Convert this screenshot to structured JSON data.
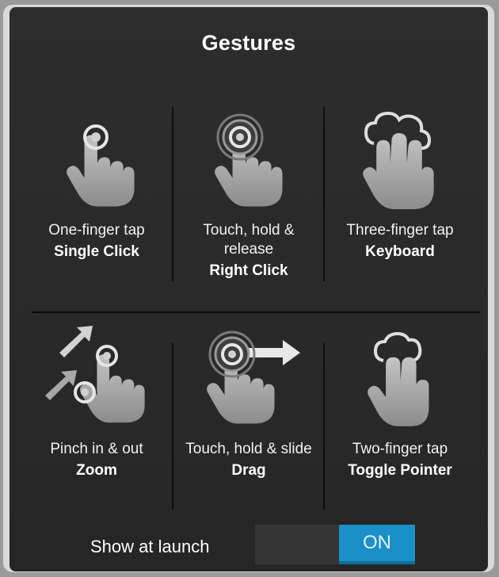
{
  "dialog": {
    "title": "Gestures"
  },
  "gestures": [
    {
      "description": "One-finger tap",
      "action": "Single Click",
      "icon": "one-finger-tap-icon"
    },
    {
      "description_lines": [
        "Touch, hold &",
        "release"
      ],
      "action": "Right Click",
      "icon": "touch-hold-release-icon"
    },
    {
      "description": "Three-finger tap",
      "action": "Keyboard",
      "icon": "three-finger-tap-icon"
    },
    {
      "description": "Pinch in & out",
      "action": "Zoom",
      "icon": "pinch-icon"
    },
    {
      "description": "Touch, hold & slide",
      "action": "Drag",
      "icon": "touch-hold-slide-icon"
    },
    {
      "description": "Two-finger tap",
      "action": "Toggle Pointer",
      "icon": "two-finger-tap-icon"
    }
  ],
  "footer": {
    "show_at_launch_label": "Show at launch",
    "toggle_state": "ON",
    "toggle_color": "#1b8fc7"
  }
}
